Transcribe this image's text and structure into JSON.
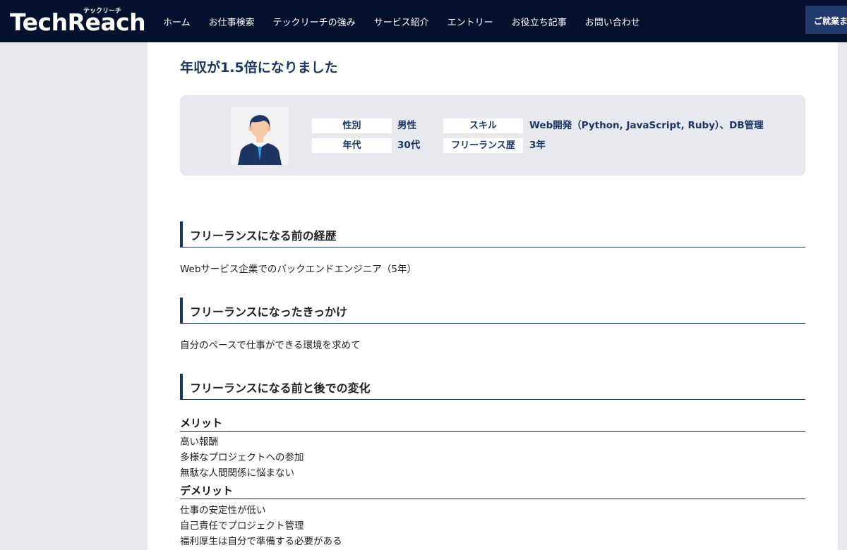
{
  "header": {
    "logo_text": "TechReach",
    "logo_sub": "テックリーチ",
    "nav": [
      "ホーム",
      "お仕事検索",
      "テックリーチの強み",
      "サービス紹介",
      "エントリー",
      "お役立ち記事",
      "お問い合わせ"
    ],
    "cta_label": "ご就業ま"
  },
  "article": {
    "title": "年収が1.5倍になりました",
    "profile": {
      "gender_label": "性別",
      "gender_value": "男性",
      "age_label": "年代",
      "age_value": "30代",
      "skill_label": "スキル",
      "skill_value": "Web開発（Python, JavaScript, Ruby）、DB管理",
      "years_label": "フリーランス歴",
      "years_value": "3年"
    },
    "sections": [
      {
        "heading": "フリーランスになる前の経歴",
        "text": "Webサービス企業でのバックエンドエンジニア（5年）"
      },
      {
        "heading": "フリーランスになったきっかけ",
        "text": "自分のペースで仕事ができる環境を求めて"
      },
      {
        "heading": "フリーランスになる前と後での変化"
      }
    ],
    "merits": {
      "heading": "メリット",
      "items": [
        "高い報酬",
        "多様なプロジェクトへの参加",
        "無駄な人間関係に悩まない"
      ]
    },
    "demerits": {
      "heading": "デメリット",
      "items": [
        "仕事の安定性が低い",
        "自己責任でプロジェクト管理",
        "福利厚生は自分で準備する必要がある"
      ]
    }
  },
  "colors": {
    "header_bg": "#04112e",
    "accent_navy": "#1d3561",
    "page_bg": "#e8e9ee"
  }
}
